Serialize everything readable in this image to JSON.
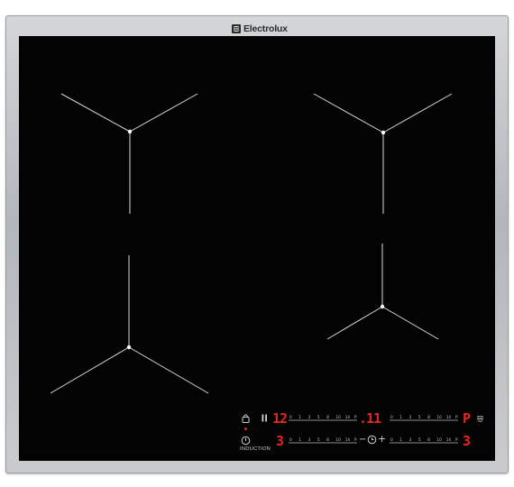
{
  "brand": {
    "name": "Electrolux"
  },
  "controls": {
    "induction_label": "INDUCTION",
    "scale_labels": [
      "0",
      "1",
      "3",
      "5",
      "8",
      "10",
      "14",
      "P"
    ],
    "zones": [
      {
        "display": "12"
      },
      {
        "display": ".11"
      },
      {
        "display": "3"
      },
      {
        "display": "3"
      }
    ],
    "right_top_display": "P"
  },
  "colors": {
    "glass": "#030303",
    "frame": "#c4c6c8",
    "display_red": "#e8261e",
    "marking": "#d9d9d9"
  }
}
